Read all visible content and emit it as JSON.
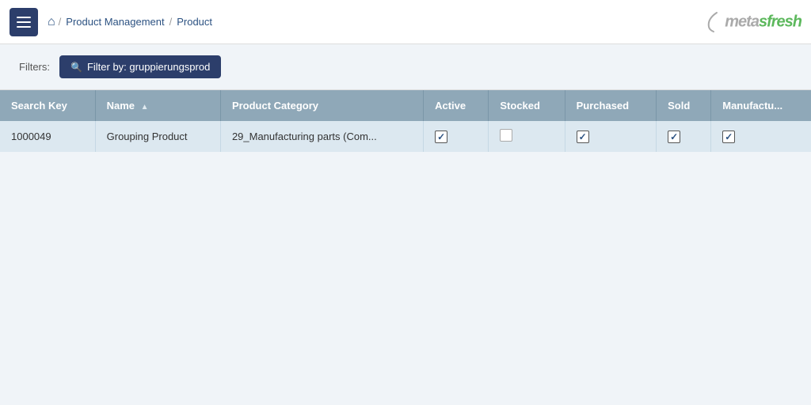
{
  "topnav": {
    "menu_icon": "menu-icon",
    "home_label": "🏠",
    "breadcrumb": [
      {
        "label": "Product Management",
        "sep": "/"
      },
      {
        "label": "Product",
        "sep": ""
      }
    ],
    "logo_prefix": "meta",
    "logo_suffix": "sfresh"
  },
  "filters": {
    "label": "Filters:",
    "filter_btn_label": "Filter by: gruppierungsprod"
  },
  "table": {
    "columns": [
      {
        "label": "Search Key",
        "sortable": false
      },
      {
        "label": "Name",
        "sortable": true
      },
      {
        "label": "Product Category",
        "sortable": false
      },
      {
        "label": "Active",
        "sortable": false
      },
      {
        "label": "Stocked",
        "sortable": false
      },
      {
        "label": "Purchased",
        "sortable": false
      },
      {
        "label": "Sold",
        "sortable": false
      },
      {
        "label": "Manufactu...",
        "sortable": false
      }
    ],
    "rows": [
      {
        "search_key": "1000049",
        "name": "Grouping Product",
        "product_category": "29_Manufacturing parts (Com...",
        "active": true,
        "stocked": false,
        "purchased": true,
        "sold": true,
        "manufactured": true
      }
    ]
  }
}
